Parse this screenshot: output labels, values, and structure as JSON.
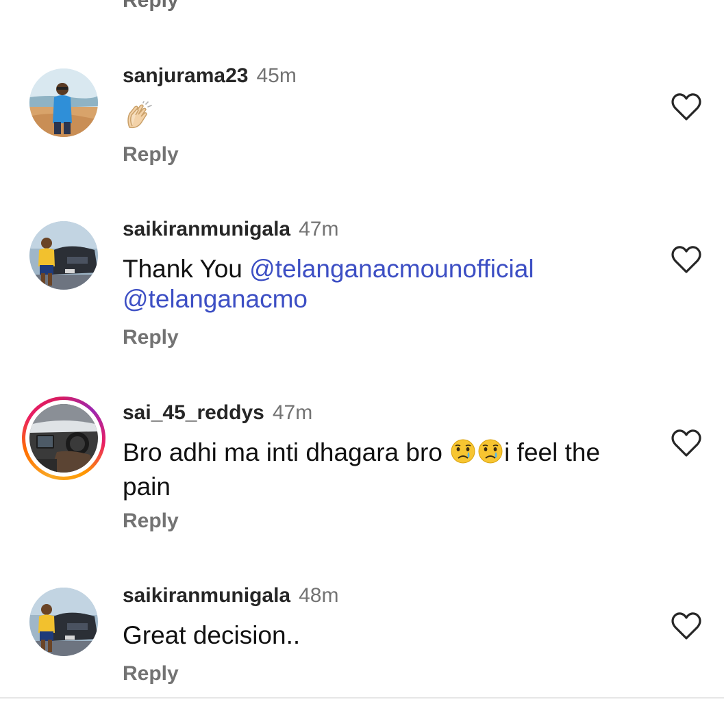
{
  "top_reply_label": "Reply",
  "colors": {
    "mention": "#3d4fc4",
    "meta_gray": "#737373",
    "story_ring": [
      "#f9a825",
      "#e91e63",
      "#9c27b0"
    ]
  },
  "comments": [
    {
      "username": "sanjurama23",
      "time": "45m",
      "text": "",
      "emoji_icon": "clapping-hands-icon",
      "reply_label": "Reply",
      "like_icon": "heart-outline-icon",
      "story_ring": false
    },
    {
      "username": "saikiranmunigala",
      "time": "47m",
      "text_prefix": "Thank You ",
      "mention_1": "@telanganacmounofficial",
      "mention_2": "@telanganacmo",
      "reply_label": "Reply",
      "like_icon": "heart-outline-icon",
      "story_ring": false
    },
    {
      "username": "sai_45_reddys",
      "time": "47m",
      "text_part1": "Bro adhi ma inti dhagara bro ",
      "emoji_icon": "crying-face-icon",
      "text_part2": "i feel the pain",
      "reply_label": "Reply",
      "like_icon": "heart-outline-icon",
      "story_ring": true
    },
    {
      "username": "saikiranmunigala",
      "time": "48m",
      "text": "Great decision..",
      "reply_label": "Reply",
      "like_icon": "heart-outline-icon",
      "story_ring": false
    }
  ]
}
